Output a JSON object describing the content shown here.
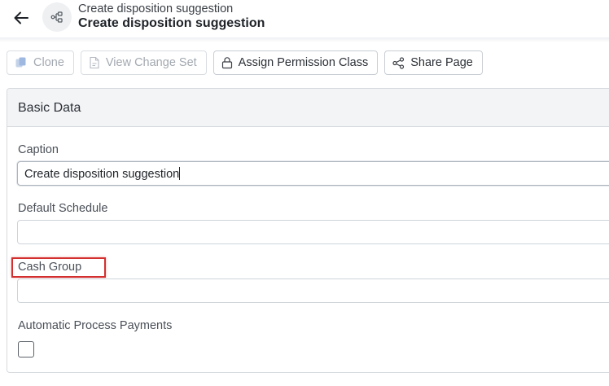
{
  "header": {
    "subtitle": "Create disposition suggestion",
    "title": "Create disposition suggestion",
    "back_icon": "arrow-left-icon",
    "app_icon": "workflow-icon"
  },
  "toolbar": {
    "buttons": [
      {
        "label": "Clone",
        "icon": "copy-icon",
        "enabled": false
      },
      {
        "label": "View Change Set",
        "icon": "document-icon",
        "enabled": false
      },
      {
        "label": "Assign Permission Class",
        "icon": "lock-icon",
        "enabled": true
      },
      {
        "label": "Share Page",
        "icon": "share-icon",
        "enabled": true
      }
    ]
  },
  "panel": {
    "title": "Basic Data",
    "fields": {
      "caption": {
        "label": "Caption",
        "value": "Create disposition suggestion"
      },
      "default_schedule": {
        "label": "Default Schedule",
        "value": ""
      },
      "cash_group": {
        "label": "Cash Group",
        "value": ""
      },
      "automatic_process_payments": {
        "label": "Automatic Process Payments",
        "checked": false
      }
    }
  },
  "colors": {
    "highlight": "#d32f2f",
    "panel_header_bg": "#f3f4f6",
    "border": "#d5d9de"
  }
}
